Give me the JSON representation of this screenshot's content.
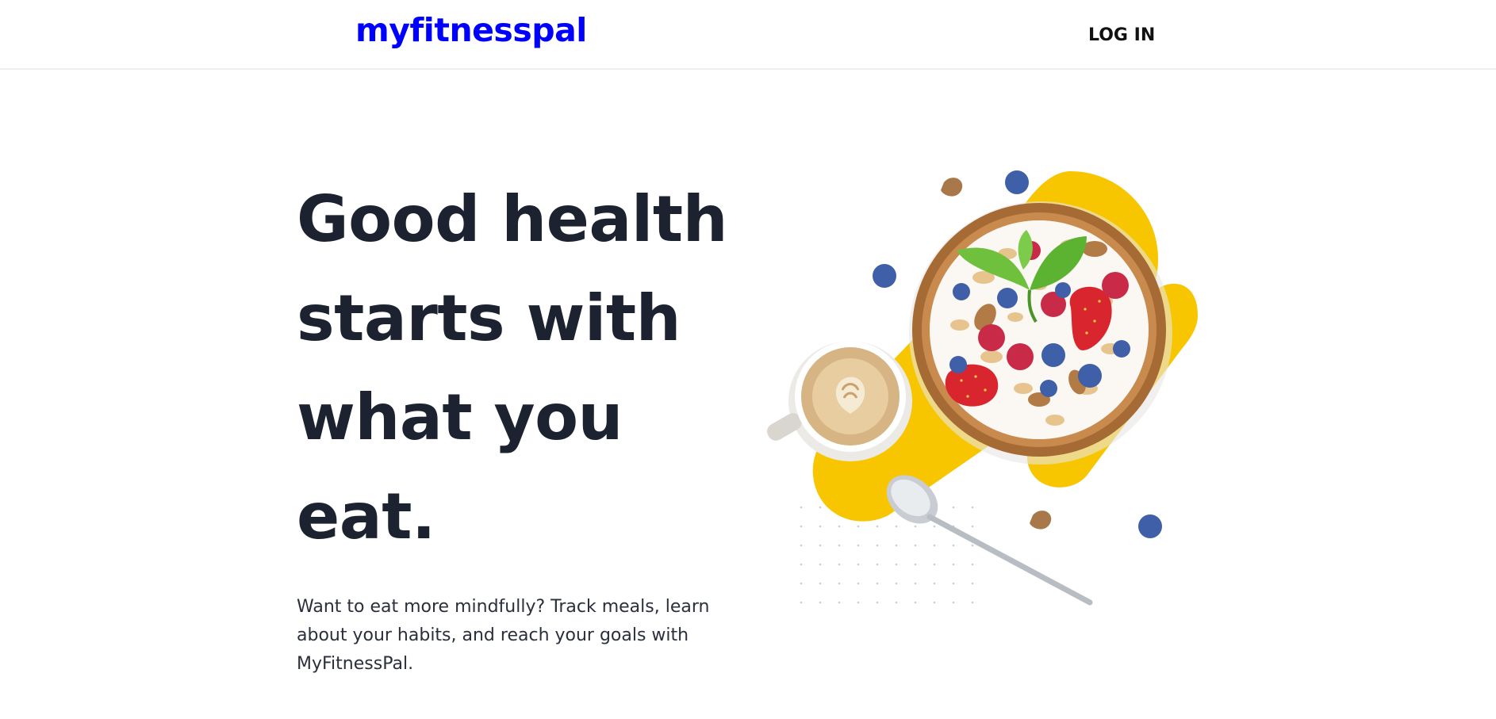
{
  "header": {
    "logo_text": "myfitnesspal",
    "login_label": "LOG IN"
  },
  "hero": {
    "headline": "Good health starts with what you eat.",
    "description": "Want to eat more mindfully? Track meals, learn about your habits, and reach your goals with MyFitnessPal."
  },
  "colors": {
    "brand": "#0000ff",
    "accent_yellow": "#f7c600",
    "headline": "#1c2230"
  },
  "illustration": {
    "icon": "breakfast-bowl-illustration"
  }
}
